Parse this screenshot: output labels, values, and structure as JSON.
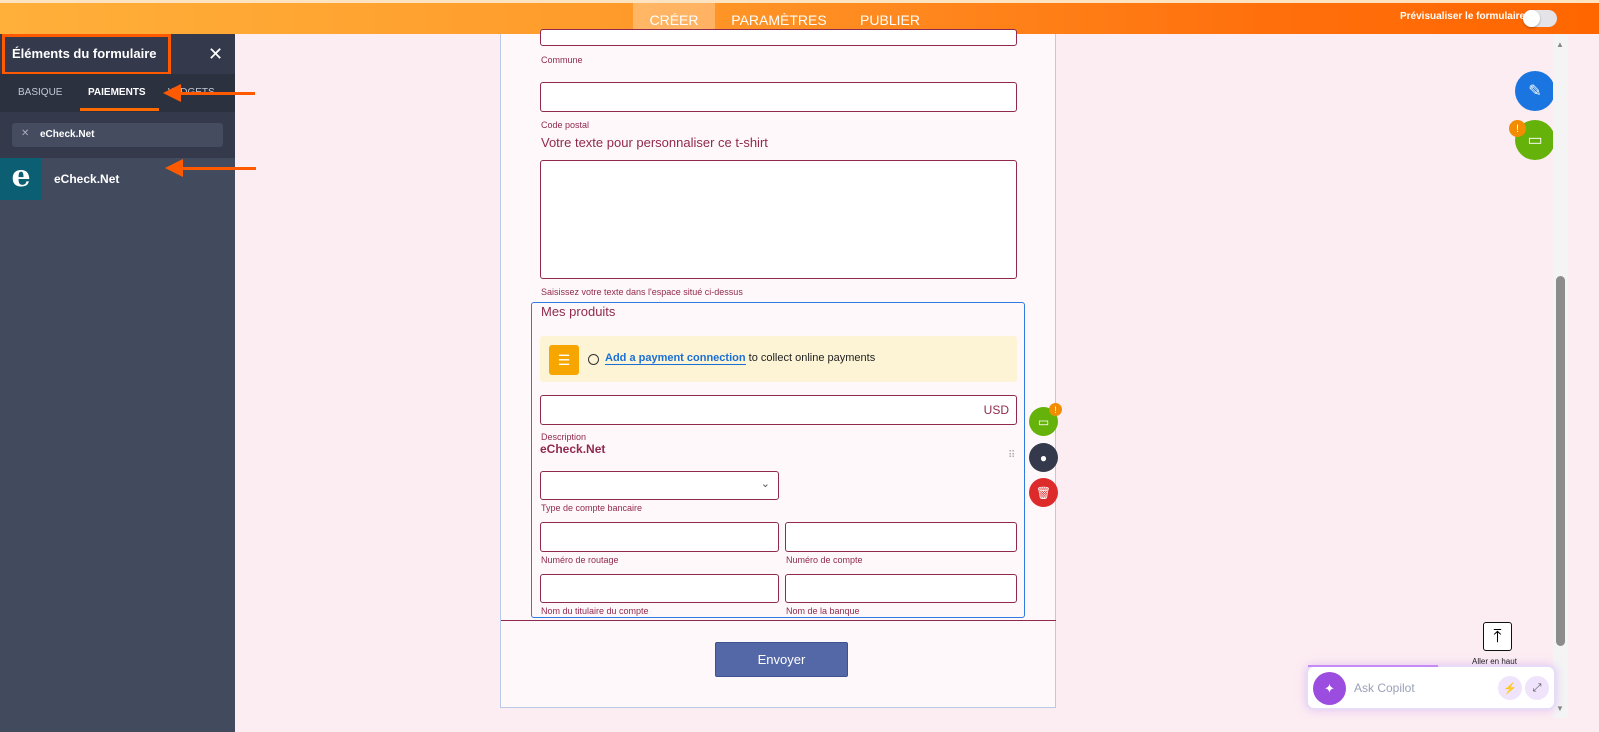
{
  "topbar": {
    "tabs": [
      "CRÉER",
      "PARAMÈTRES",
      "PUBLIER"
    ],
    "preview_label": "Prévisualiser le formulaire",
    "preview_on": false
  },
  "sidebar": {
    "title": "Éléments du formulaire",
    "tabs": [
      "BASIQUE",
      "PAIEMENTS",
      "WIDGETS"
    ],
    "active_tab": "PAIEMENTS",
    "search_value": "eCheck.Net",
    "results": [
      {
        "label": "eCheck.Net",
        "icon_letter": "e"
      }
    ]
  },
  "form": {
    "commune_label": "Commune",
    "postal_label": "Code postal",
    "custom_text_label": "Votre texte pour personnaliser ce t-shirt",
    "custom_text_hint": "Saisissez votre texte dans l'espace situé ci-dessus",
    "products_title": "Mes produits",
    "notice_link": "Add a payment connection",
    "notice_text": " to collect online payments",
    "currency": "USD",
    "description_label": "Description",
    "gateway_name": "eCheck.Net",
    "account_type_label": "Type de compte bancaire",
    "routing_label": "Numéro de routage",
    "account_number_label": "Numéro de compte",
    "holder_label": "Nom du titulaire du compte",
    "bank_label": "Nom de la banque",
    "submit_label": "Envoyer"
  },
  "tools": {
    "go_top_label": "Aller en haut",
    "copilot_placeholder": "Ask Copilot",
    "warning_badge": "!"
  },
  "colors": {
    "accent": "#ff6f0c",
    "field_border": "#8f2a4e",
    "submit": "#5468a8"
  }
}
